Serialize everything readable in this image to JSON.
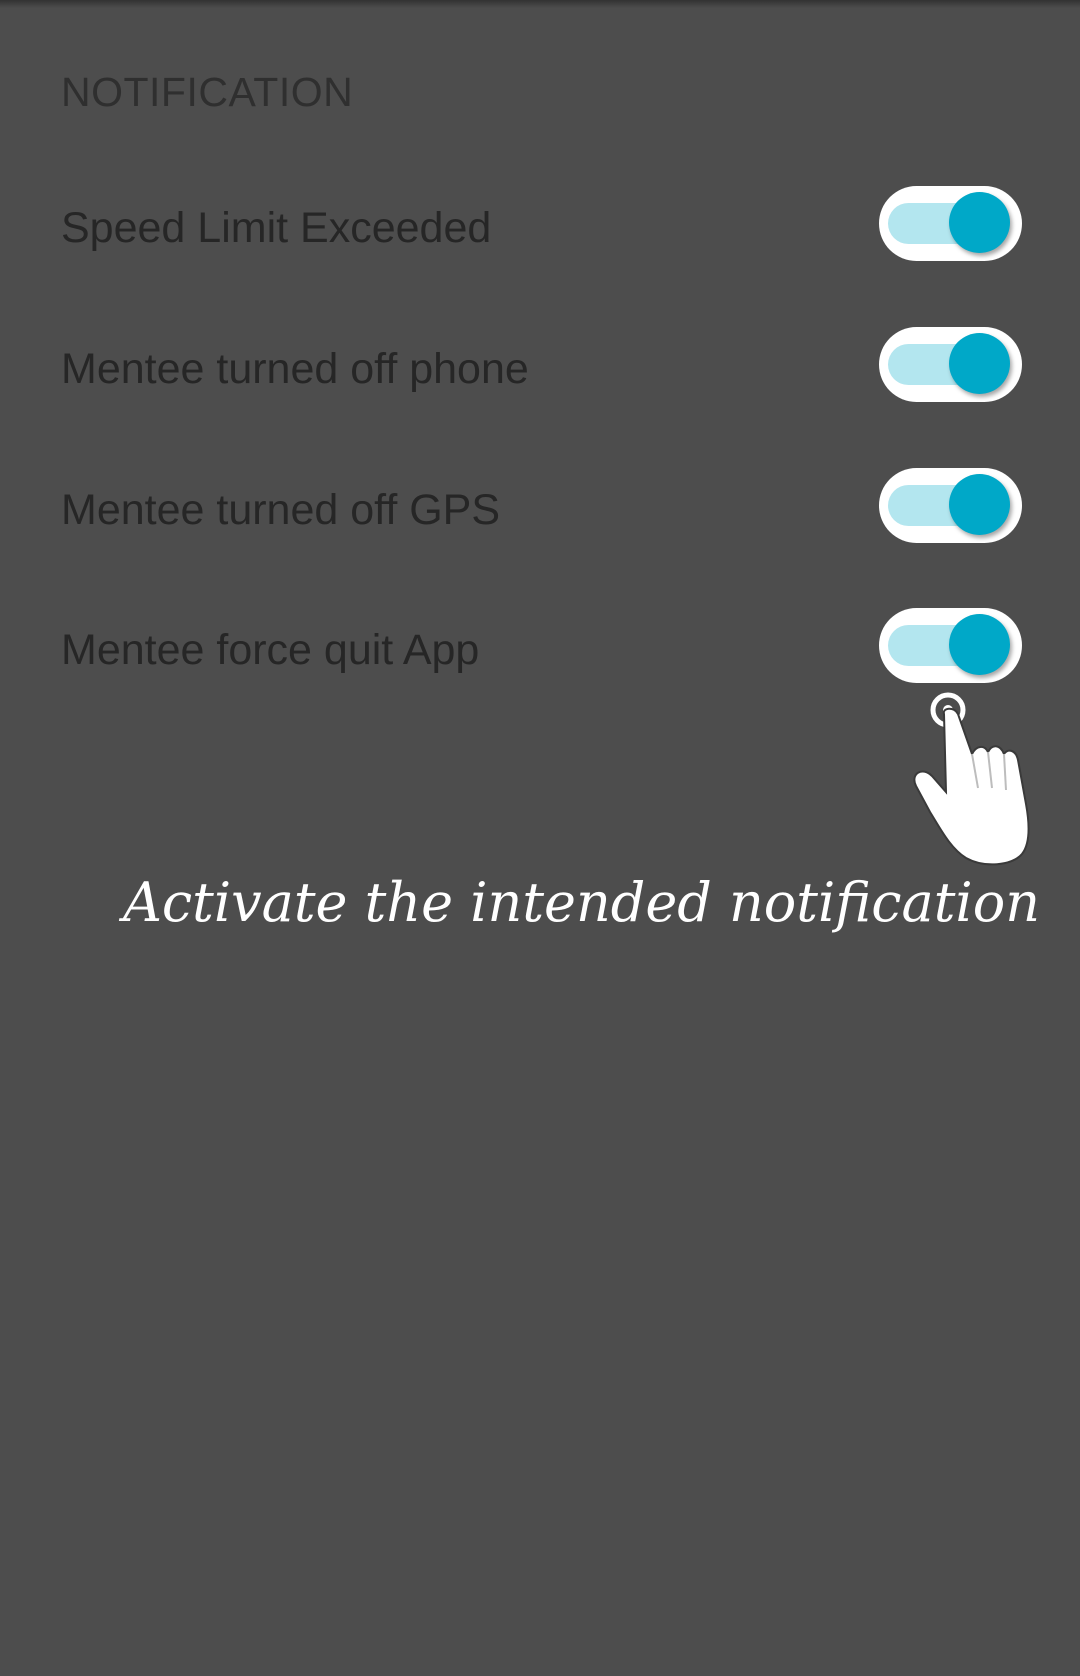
{
  "section": {
    "title": "NOTIFICATION"
  },
  "settings": [
    {
      "label": "Speed Limit Exceeded",
      "enabled": true
    },
    {
      "label": "Mentee turned off phone",
      "enabled": true
    },
    {
      "label": "Mentee turned off GPS",
      "enabled": true
    },
    {
      "label": "Mentee force quit App",
      "enabled": true
    }
  ],
  "hint": {
    "text": "Activate the intended notification",
    "icon": "tap-hand-icon"
  },
  "colors": {
    "background": "#4d4d4d",
    "switch_track_on": "#b3e6ef",
    "switch_thumb_on": "#00a8c8",
    "switch_frame": "#ffffff",
    "label_text": "#262626",
    "hint_text": "#ffffff"
  }
}
